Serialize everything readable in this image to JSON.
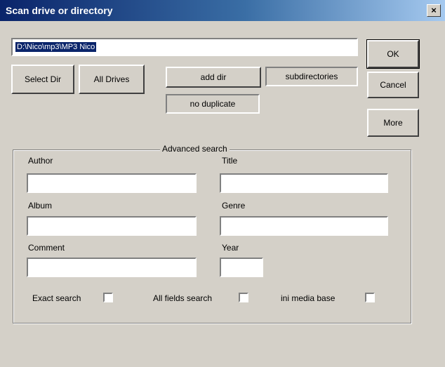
{
  "window": {
    "title": "Scan drive or directory",
    "close_glyph": "×"
  },
  "path": {
    "value": "D:\\Nico\\mp3\\MP3 Nico"
  },
  "buttons": {
    "select_dir": "Select Dir",
    "all_drives": "All Drives",
    "add_dir": "add dir",
    "ok": "OK",
    "cancel": "Cancel",
    "more": "More"
  },
  "toggles": {
    "subdirectories": "subdirectories",
    "no_duplicate": "no duplicate"
  },
  "advanced": {
    "title": "Advanced search",
    "author": {
      "label": "Author",
      "value": ""
    },
    "title_field": {
      "label": "Title",
      "value": ""
    },
    "album": {
      "label": "Album",
      "value": ""
    },
    "genre": {
      "label": "Genre",
      "value": ""
    },
    "comment": {
      "label": "Comment",
      "value": ""
    },
    "year": {
      "label": "Year",
      "value": ""
    },
    "options": {
      "exact_search": "Exact search",
      "all_fields_search": "All fields search",
      "ini_media_base": "ini media base"
    }
  }
}
